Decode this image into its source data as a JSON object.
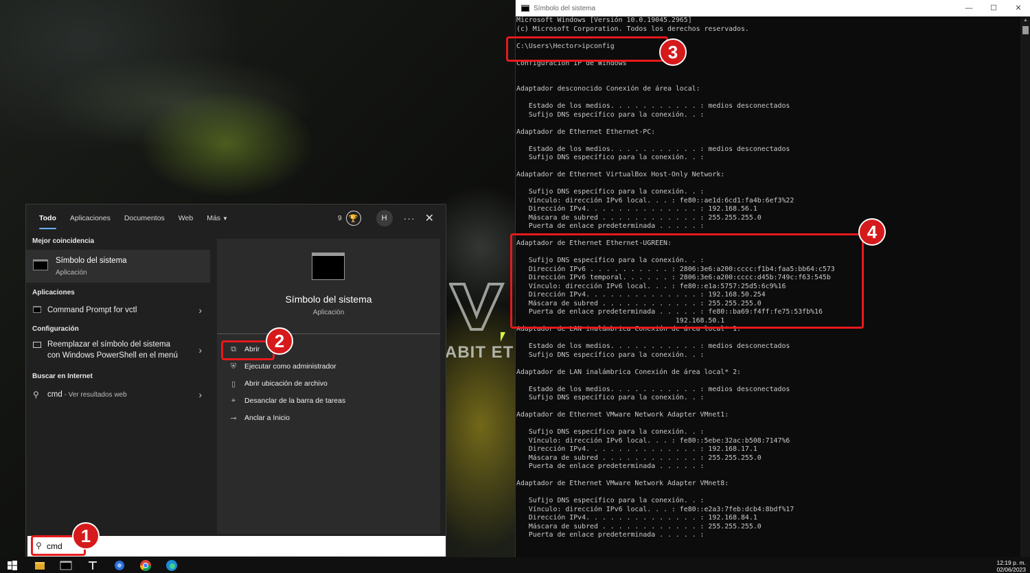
{
  "search_panel": {
    "tabs": [
      "Todo",
      "Aplicaciones",
      "Documentos",
      "Web",
      "Más"
    ],
    "rewards_count": "9",
    "avatar_initial": "H",
    "more_icon": "ellipsis-icon",
    "close_icon": "close-icon",
    "best_match_header": "Mejor coincidencia",
    "best_match": {
      "title": "Símbolo del sistema",
      "subtitle": "Aplicación"
    },
    "apps_header": "Aplicaciones",
    "apps": [
      "Command Prompt for vctl"
    ],
    "settings_header": "Configuración",
    "settings_item": [
      "Reemplazar el símbolo del sistema",
      "con Windows PowerShell en el menú"
    ],
    "web_header": "Buscar en Internet",
    "web_item": {
      "query": "cmd",
      "suffix": " - Ver resultados web"
    },
    "preview": {
      "title": "Símbolo del sistema",
      "subtitle": "Aplicación",
      "actions": [
        "Abrir",
        "Ejecutar como administrador",
        "Abrir ubicación de archivo",
        "Desanclar de la barra de tareas",
        "Anclar a Inicio"
      ]
    },
    "search_value": "cmd"
  },
  "console": {
    "title": "Símbolo del sistema",
    "output": "Microsoft Windows [Versión 10.0.19045.2965]\n(c) Microsoft Corporation. Todos los derechos reservados.\n\nC:\\Users\\Hector>ipconfig\n\nConfiguración IP de Windows\n\n\nAdaptador desconocido Conexión de área local:\n\n   Estado de los medios. . . . . . . . . . . : medios desconectados\n   Sufijo DNS específico para la conexión. . :\n\nAdaptador de Ethernet Ethernet-PC:\n\n   Estado de los medios. . . . . . . . . . . : medios desconectados\n   Sufijo DNS específico para la conexión. . :\n\nAdaptador de Ethernet VirtualBox Host-Only Network:\n\n   Sufijo DNS específico para la conexión. . :\n   Vínculo: dirección IPv6 local. . . : fe80::ae1d:6cd1:fa4b:6ef3%22\n   Dirección IPv4. . . . . . . . . . . . . . : 192.168.56.1\n   Máscara de subred . . . . . . . . . . . . : 255.255.255.0\n   Puerta de enlace predeterminada . . . . . :\n\nAdaptador de Ethernet Ethernet-UGREEN:\n\n   Sufijo DNS específico para la conexión. . :\n   Dirección IPv6 . . . . . . . . . . : 2806:3e6:a200:cccc:f1b4:faa5:bb64:c573\n   Dirección IPv6 temporal. . . . . . : 2806:3e6:a200:cccc:d45b:749c:f63:545b\n   Vínculo: dirección IPv6 local. . . : fe80::e1a:5757:25d5:6c9%16\n   Dirección IPv4. . . . . . . . . . . . . . : 192.168.50.254\n   Máscara de subred . . . . . . . . . . . . : 255.255.255.0\n   Puerta de enlace predeterminada . . . . . : fe80::ba69:f4ff:fe75:53fb%16\n                                       192.168.50.1\nAdaptador de LAN inalámbrica Conexión de área local* 1:\n\n   Estado de los medios. . . . . . . . . . . : medios desconectados\n   Sufijo DNS específico para la conexión. . :\n\nAdaptador de LAN inalámbrica Conexión de área local* 2:\n\n   Estado de los medios. . . . . . . . . . . : medios desconectados\n   Sufijo DNS específico para la conexión. . :\n\nAdaptador de Ethernet VMware Network Adapter VMnet1:\n\n   Sufijo DNS específico para la conexión. . :\n   Vínculo: dirección IPv6 local. . . : fe80::5ebe:32ac:b508:7147%6\n   Dirección IPv4. . . . . . . . . . . . . . : 192.168.17.1\n   Máscara de subred . . . . . . . . . . . . : 255.255.255.0\n   Puerta de enlace predeterminada . . . . . :\n\nAdaptador de Ethernet VMware Network Adapter VMnet8:\n\n   Sufijo DNS específico para la conexión. . :\n   Vínculo: dirección IPv6 local. . . : fe80::e2a3:7feb:dcb4:8bdf%17\n   Dirección IPv4. . . . . . . . . . . . . . : 192.168.84.1\n   Máscara de subred . . . . . . . . . . . . : 255.255.255.0\n   Puerta de enlace predeterminada . . . . . :"
  },
  "annotations": [
    "1",
    "2",
    "3",
    "4"
  ],
  "wallpaper_text": "ABIT ETHER",
  "taskbar": {
    "icons": [
      "windows-start-icon",
      "file-explorer-icon",
      "terminal-icon",
      "tool-icon",
      "app-icon",
      "chrome-icon",
      "edge-icon"
    ],
    "time": "12:19 p. m.",
    "date": "02/06/2023"
  },
  "colors": {
    "highlight": "#e8191c",
    "accent": "#6bb0ff",
    "console_bg": "#0c0c0c"
  }
}
